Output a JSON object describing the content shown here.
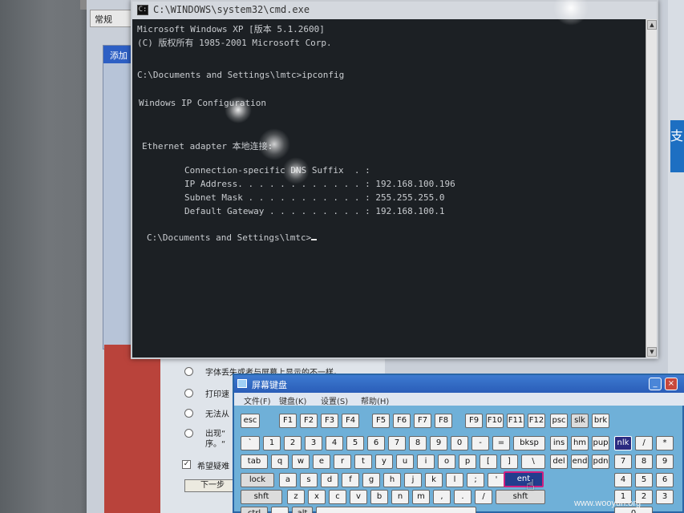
{
  "background_window": {
    "tab_label": "常规",
    "panel_title": "添加",
    "right_badge": "支",
    "options": [
      "字体丢失或者与屏幕上显示的不一样。",
      "打印速",
      "无法从",
      "出现“",
      "序。“"
    ],
    "checkbox_label": "希望疑难",
    "next_button": "下一步"
  },
  "cmd": {
    "title": "C:\\WINDOWS\\system32\\cmd.exe",
    "lines": [
      "Microsoft Windows XP [版本 5.1.2600]",
      "(C) 版权所有 1985-2001 Microsoft Corp.",
      "",
      "C:\\Documents and Settings\\lmtc>ipconfig",
      "",
      "Windows IP Configuration",
      "",
      "",
      "Ethernet adapter 本地连接:",
      "",
      "        Connection-specific DNS Suffix  . :",
      "        IP Address. . . . . . . . . . . . : 192.168.100.196",
      "        Subnet Mask . . . . . . . . . . . : 255.255.255.0",
      "        Default Gateway . . . . . . . . . : 192.168.100.1",
      "",
      "C:\\Documents and Settings\\lmtc>"
    ]
  },
  "osk": {
    "title": "屏幕键盘",
    "menu": [
      "文件(F)",
      "键盘(K)",
      "设置(S)",
      "帮助(H)"
    ],
    "keys": {
      "esc": "esc",
      "f1": "F1",
      "f2": "F2",
      "f3": "F3",
      "f4": "F4",
      "f5": "F5",
      "f6": "F6",
      "f7": "F7",
      "f8": "F8",
      "f9": "F9",
      "f10": "F10",
      "f11": "F11",
      "f12": "F12",
      "psc": "psc",
      "slk": "slk",
      "brk": "brk",
      "backtick": "`",
      "k1": "1",
      "k2": "2",
      "k3": "3",
      "k4": "4",
      "k5": "5",
      "k6": "6",
      "k7": "7",
      "k8": "8",
      "k9": "9",
      "k0": "0",
      "minus": "-",
      "equals": "=",
      "bksp": "bksp",
      "ins": "ins",
      "hm": "hm",
      "pup": "pup",
      "nlk": "nlk",
      "np_div": "/",
      "np_mul": "*",
      "tab": "tab",
      "q": "q",
      "w": "w",
      "e": "e",
      "r": "r",
      "t": "t",
      "y": "y",
      "u": "u",
      "i": "i",
      "o": "o",
      "p": "p",
      "lbr": "[",
      "rbr": "]",
      "bslash": "\\",
      "del": "del",
      "end": "end",
      "pdn": "pdn",
      "np7": "7",
      "np8": "8",
      "np9": "9",
      "lock": "lock",
      "a": "a",
      "s": "s",
      "d": "d",
      "f": "f",
      "g": "g",
      "h": "h",
      "j": "j",
      "k": "k",
      "l": "l",
      "semi": ";",
      "quote": "'",
      "ent": "ent",
      "np4": "4",
      "np5": "5",
      "np6": "6",
      "shft": "shft",
      "z": "z",
      "x": "x",
      "c": "c",
      "v": "v",
      "b": "b",
      "n": "n",
      "m": "m",
      "comma": ",",
      "period": ".",
      "slash": "/",
      "shft_r": "shft",
      "np1": "1",
      "np2": "2",
      "np3": "3",
      "ctrl": "ctrl",
      "alt": "alt",
      "np0": "0"
    }
  },
  "watermark": "www.wooyun.org",
  "colors": {
    "console_bg": "#1c2024",
    "console_text": "#c9ccd0",
    "osk_bg": "#6fb0d8",
    "osk_title": "#2a5db8",
    "highlight_key": "#233d8e"
  }
}
